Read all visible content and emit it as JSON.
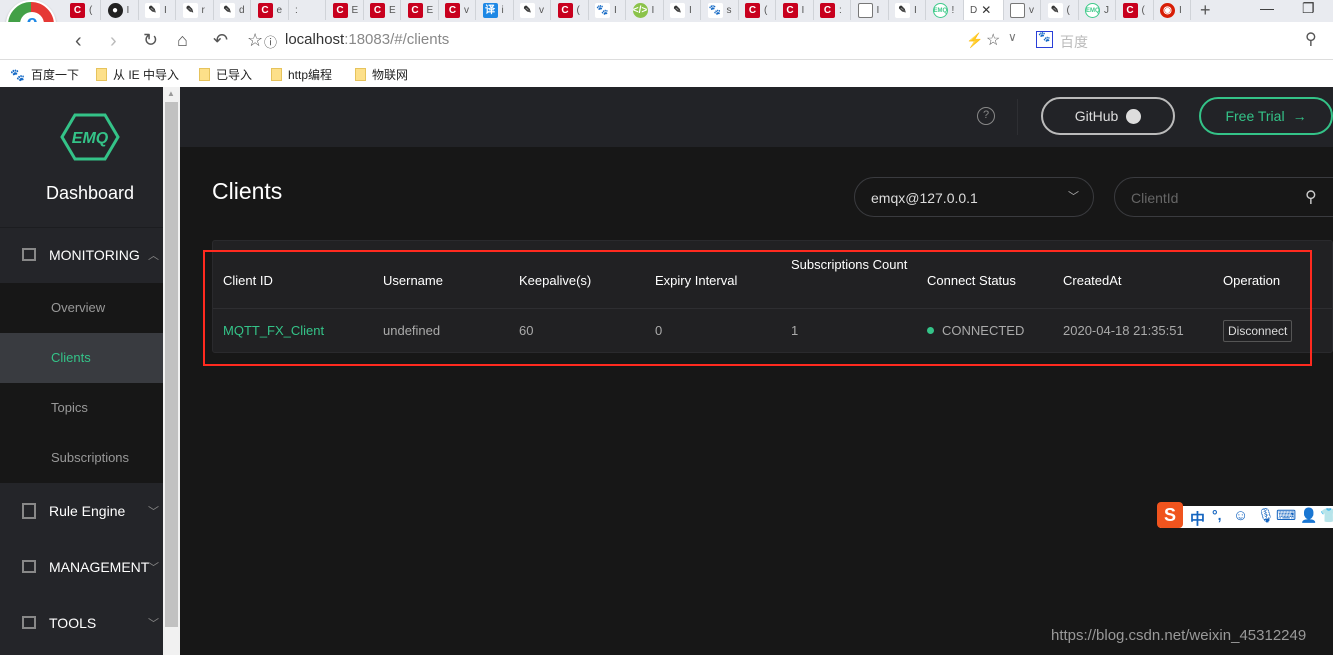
{
  "browser": {
    "tabs": [
      {
        "icon": "c",
        "t": "("
      },
      {
        "icon": "gh",
        "t": "I"
      },
      {
        "icon": "pen",
        "t": "I"
      },
      {
        "icon": "pen",
        "t": "r"
      },
      {
        "icon": "pen",
        "t": "d"
      },
      {
        "icon": "c",
        "t": "e"
      },
      {
        "icon": "none",
        "t": ":"
      },
      {
        "icon": "c",
        "t": "E"
      },
      {
        "icon": "c",
        "t": "E"
      },
      {
        "icon": "c",
        "t": "E"
      },
      {
        "icon": "c",
        "t": "v"
      },
      {
        "icon": "yi",
        "t": "i"
      },
      {
        "icon": "pen",
        "t": "v"
      },
      {
        "icon": "c",
        "t": "("
      },
      {
        "icon": "bd",
        "t": "I"
      },
      {
        "icon": "g",
        "t": "I"
      },
      {
        "icon": "pen",
        "t": "I"
      },
      {
        "icon": "bd",
        "t": "s"
      },
      {
        "icon": "c",
        "t": "("
      },
      {
        "icon": "c",
        "t": "I"
      },
      {
        "icon": "c",
        "t": ":"
      },
      {
        "icon": "doc",
        "t": "I"
      },
      {
        "icon": "pen",
        "t": "I"
      },
      {
        "icon": "emq",
        "t": "!"
      },
      {
        "icon": "active",
        "t": "D"
      },
      {
        "icon": "doc",
        "t": "v"
      },
      {
        "icon": "pen",
        "t": "("
      },
      {
        "icon": "emq",
        "t": "J"
      },
      {
        "icon": "c",
        "t": "("
      },
      {
        "icon": "wy",
        "t": "I"
      }
    ],
    "url_host": "localhost",
    "url_rest": ":18083/#/clients",
    "search_placeholder": "百度",
    "bookmarks": [
      "百度一下",
      "从 IE 中导入",
      "已导入",
      "http编程",
      "物联网"
    ]
  },
  "sidebar": {
    "brand": "Dashboard",
    "logo_text": "EMQ",
    "menus": [
      {
        "label": "MONITORING",
        "icon": "monitor-icon"
      },
      {
        "label": "Rule Engine",
        "icon": "rule-icon"
      },
      {
        "label": "MANAGEMENT",
        "icon": "management-icon"
      },
      {
        "label": "TOOLS",
        "icon": "toolbox-icon"
      }
    ],
    "submenu": [
      {
        "label": "Overview"
      },
      {
        "label": "Clients",
        "active": true
      },
      {
        "label": "Topics"
      },
      {
        "label": "Subscriptions"
      }
    ]
  },
  "header": {
    "help": "?",
    "github": "GitHub",
    "free_trial": "Free Trial"
  },
  "page": {
    "title": "Clients",
    "node_select": "emqx@127.0.0.1",
    "search_placeholder": "ClientId",
    "columns": [
      "Client ID",
      "Username",
      "Keepalive(s)",
      "Expiry Interval",
      "Subscriptions Count",
      "Connect Status",
      "CreatedAt",
      "Operation"
    ],
    "rows": [
      {
        "client_id": "MQTT_FX_Client",
        "username": "undefined",
        "keepalive": "60",
        "expiry": "0",
        "subs": "1",
        "status": "CONNECTED",
        "created": "2020-04-18 21:35:51",
        "op": "Disconnect"
      }
    ]
  },
  "colors": {
    "accent": "#34c388",
    "highlight_box": "#ff2a1f"
  },
  "ime": {
    "lang": "中",
    "punct": "°,"
  },
  "watermark": "https://blog.csdn.net/weixin_45312249"
}
